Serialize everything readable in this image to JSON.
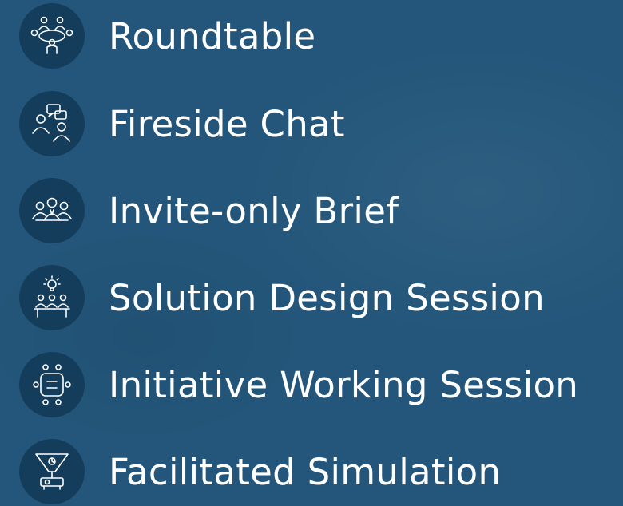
{
  "items": [
    {
      "icon": "roundtable-icon",
      "label": "Roundtable"
    },
    {
      "icon": "fireside-chat-icon",
      "label": "Fireside Chat"
    },
    {
      "icon": "group-brief-icon",
      "label": "Invite-only Brief"
    },
    {
      "icon": "lightbulb-team-icon",
      "label": "Solution Design Session"
    },
    {
      "icon": "working-table-icon",
      "label": "Initiative Working Session"
    },
    {
      "icon": "simulation-projector-icon",
      "label": "Facilitated Simulation"
    }
  ]
}
